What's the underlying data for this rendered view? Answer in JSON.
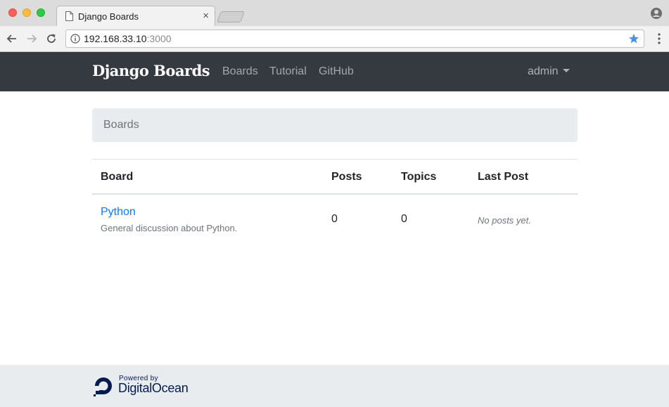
{
  "browser": {
    "tab_title": "Django Boards",
    "tab_close": "×",
    "url_host": "192.168.33.10",
    "url_port": ":3000"
  },
  "navbar": {
    "brand": "Django Boards",
    "links": [
      "Boards",
      "Tutorial",
      "GitHub"
    ],
    "user": "admin"
  },
  "breadcrumb": {
    "items": [
      "Boards"
    ]
  },
  "table": {
    "headers": [
      "Board",
      "Posts",
      "Topics",
      "Last Post"
    ],
    "rows": [
      {
        "name": "Python",
        "description": "General discussion about Python.",
        "posts": "0",
        "topics": "0",
        "last_post": "No posts yet."
      }
    ]
  },
  "footer": {
    "powered_by": "Powered by",
    "sponsor": "DigitalOcean"
  },
  "colors": {
    "navbar_bg": "#343a40",
    "link": "#007bff",
    "breadcrumb_bg": "#e9ecef",
    "star": "#4a90e2"
  }
}
